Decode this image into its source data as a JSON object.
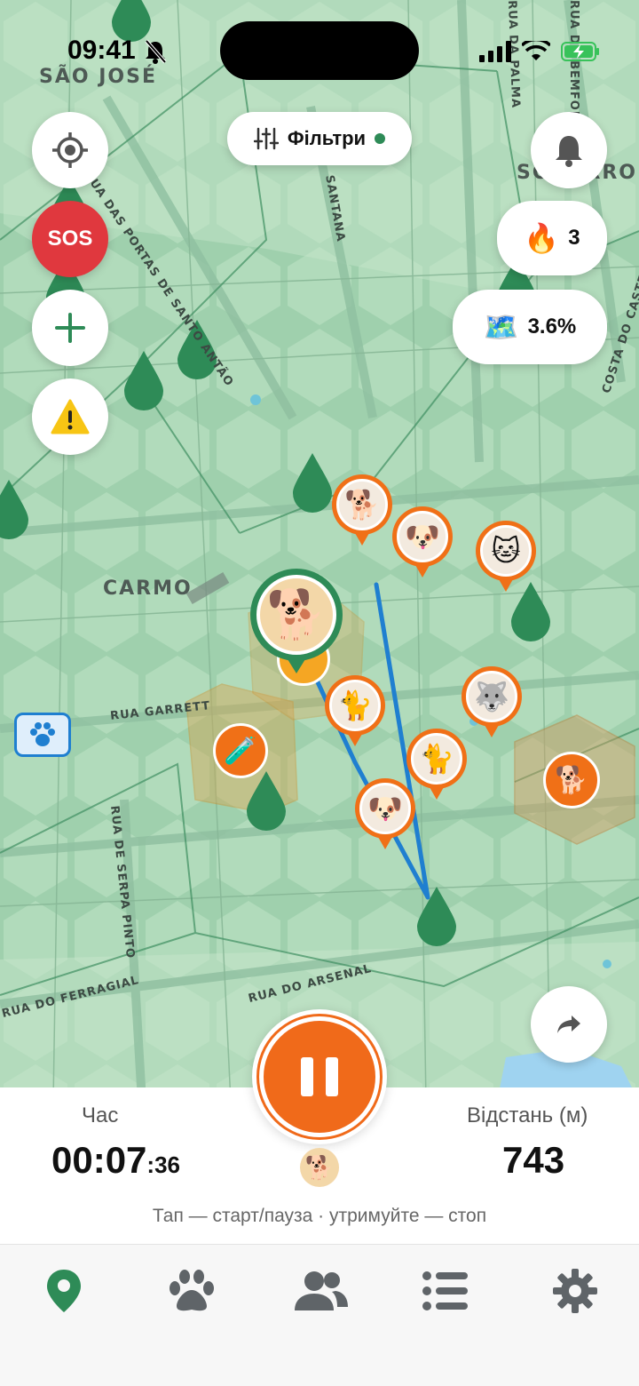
{
  "status_bar": {
    "time": "09:41"
  },
  "map": {
    "districts": [
      "SÃO JOSÉ",
      "CARMO",
      "SOCORRO"
    ],
    "streets": [
      "RUA DAS PORTAS DE SANTO ANTÃO",
      "SANTANA",
      "RUA GARRETT",
      "RUA DE SERPA PINTO",
      "RUA DO ARSENAL",
      "RUA DO FERRAGIAL",
      "COSTA DO CASTELO",
      "RUA DA PALMA",
      "RUA DO BEMFORMOSO"
    ]
  },
  "controls": {
    "locate_icon": "crosshair-icon",
    "sos_label": "SOS",
    "add_icon": "plus-icon",
    "warning_icon": "warning-icon",
    "filter_label": "Фільтри",
    "bell_icon": "bell-icon",
    "streak_icon": "fire-icon",
    "streak_value": "3",
    "coverage_icon": "map-icon",
    "coverage_value": "3.6%",
    "share_icon": "share-icon"
  },
  "markers": [
    {
      "name": "corgi",
      "emoji": "🐕"
    },
    {
      "name": "dalmatian",
      "emoji": "🐶"
    },
    {
      "name": "siamese",
      "emoji": "🐱"
    },
    {
      "name": "maine-coon",
      "emoji": "🐈"
    },
    {
      "name": "husky",
      "emoji": "🐺"
    },
    {
      "name": "british-shorthair",
      "emoji": "🐈"
    },
    {
      "name": "french-bulldog",
      "emoji": "🐶"
    },
    {
      "name": "golden-retriever",
      "emoji": "🐕"
    },
    {
      "name": "test-tube",
      "emoji": "🧪"
    },
    {
      "name": "walking-dog",
      "emoji": "🐕"
    }
  ],
  "stats": {
    "time_label": "Час",
    "time_main": "00:07",
    "time_seconds": ":36",
    "distance_label": "Відстань (м)",
    "distance_value": "743",
    "hint": "Тап — старт/пауза · утримуйте — стоп"
  },
  "tabs": [
    {
      "name": "map",
      "active": true
    },
    {
      "name": "pets",
      "active": false
    },
    {
      "name": "friends",
      "active": false
    },
    {
      "name": "list",
      "active": false
    },
    {
      "name": "settings",
      "active": false
    }
  ],
  "colors": {
    "accent": "#2e8b57",
    "orange": "#f06a1a",
    "sos": "#e0383e",
    "route": "#1f7fd0"
  }
}
